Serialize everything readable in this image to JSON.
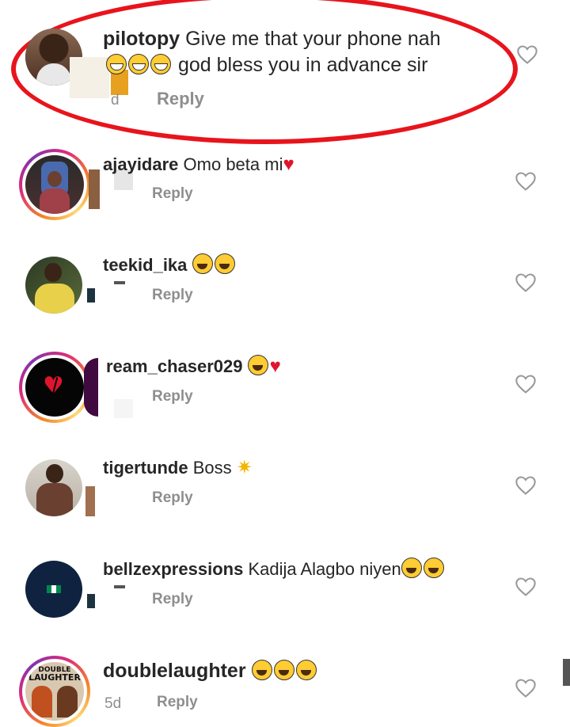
{
  "comments": [
    {
      "username": "pilotopy",
      "text_line1": "Give me that your phone nah",
      "text_line2": "god bless you in advance sir",
      "time": "d",
      "reply": "Reply"
    },
    {
      "username": "ajayidare",
      "text": "Omo beta mi",
      "reply": "Reply"
    },
    {
      "username": "teekid_ika",
      "text": "",
      "reply": "Reply"
    },
    {
      "username": "ream_chaser029",
      "text": "",
      "reply": "Reply"
    },
    {
      "username": "tigertunde",
      "text": "Boss",
      "reply": "Reply"
    },
    {
      "username": "bellzexpressions",
      "text": "Kadija Alagbo niyen",
      "reply": "Reply"
    },
    {
      "username": "doublelaughter",
      "text": "",
      "time": "5d",
      "reply": "Reply"
    }
  ],
  "avatar_labels": {
    "double": "DOUBLE",
    "laughter": "LAUGHTER"
  },
  "icons": {
    "like": "heart-outline-icon",
    "broken_heart": "broken-heart-icon"
  },
  "colors": {
    "highlight": "#e8141c",
    "reply": "#8e8e8e",
    "text": "#262626"
  }
}
